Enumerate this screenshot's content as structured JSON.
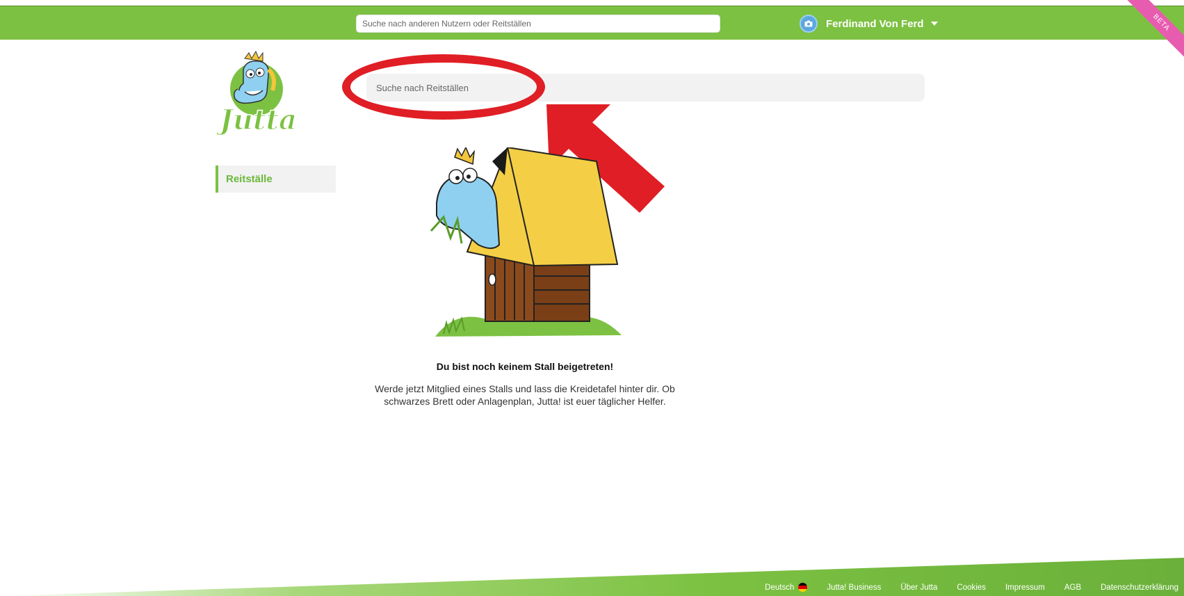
{
  "header": {
    "search_placeholder": "Suche nach anderen Nutzern oder Reitställen",
    "user_name": "Ferdinand Von Ferd",
    "beta_label": "BETA"
  },
  "logo": {
    "text": "Jutta!"
  },
  "sidebar": {
    "items": [
      {
        "label": "Reitställe",
        "active": true
      }
    ]
  },
  "main": {
    "search_placeholder": "Suche nach Reitställen",
    "empty_title": "Du bist noch keinem Stall beigetreten!",
    "empty_text": "Werde jetzt Mitglied eines Stalls und lass die Kreidetafel hinter dir. Ob schwarzes Brett oder Anlagenplan, Jutta! ist euer täglicher Helfer."
  },
  "annotations": {
    "highlight_color": "#e01e25"
  },
  "footer": {
    "language": "Deutsch",
    "links": [
      "Jutta! Business",
      "Über Jutta",
      "Cookies",
      "Impressum",
      "AGB",
      "Datenschutzerklärung"
    ]
  },
  "colors": {
    "brand_green": "#7cc142",
    "sidebar_active_text": "#6ab83b",
    "beta_pink": "#e85cb0"
  },
  "icons": {
    "avatar": "camera-icon",
    "dropdown": "chevron-down-icon",
    "language": "german-flag-icon"
  }
}
